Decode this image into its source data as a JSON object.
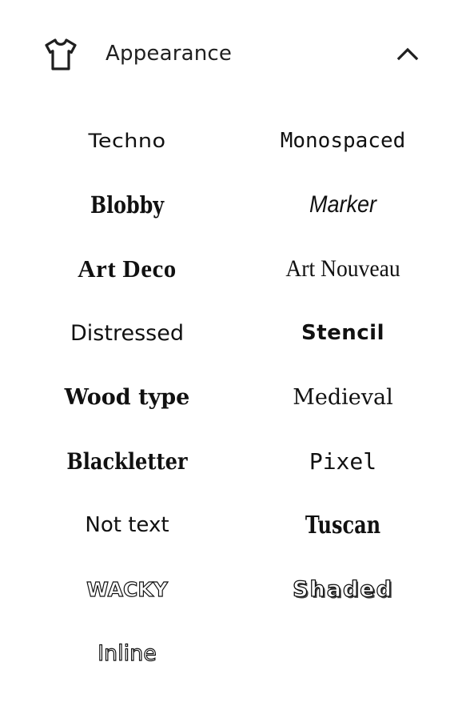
{
  "header": {
    "title": "Appearance",
    "icon": "t-shirt-icon",
    "toggle_icon": "chevron-up-icon"
  },
  "fonts": [
    "Techno",
    "Monospaced",
    "Blobby",
    "Marker",
    "Art Deco",
    "Art Nouveau",
    "Distressed",
    "Stencil",
    "Wood type",
    "Medieval",
    "Blackletter",
    "Pixel",
    "Not text",
    "Tuscan",
    "WACKY",
    "Shaded",
    "Inline"
  ],
  "colors": {
    "text": "#1f1f1f",
    "background": "#ffffff"
  }
}
